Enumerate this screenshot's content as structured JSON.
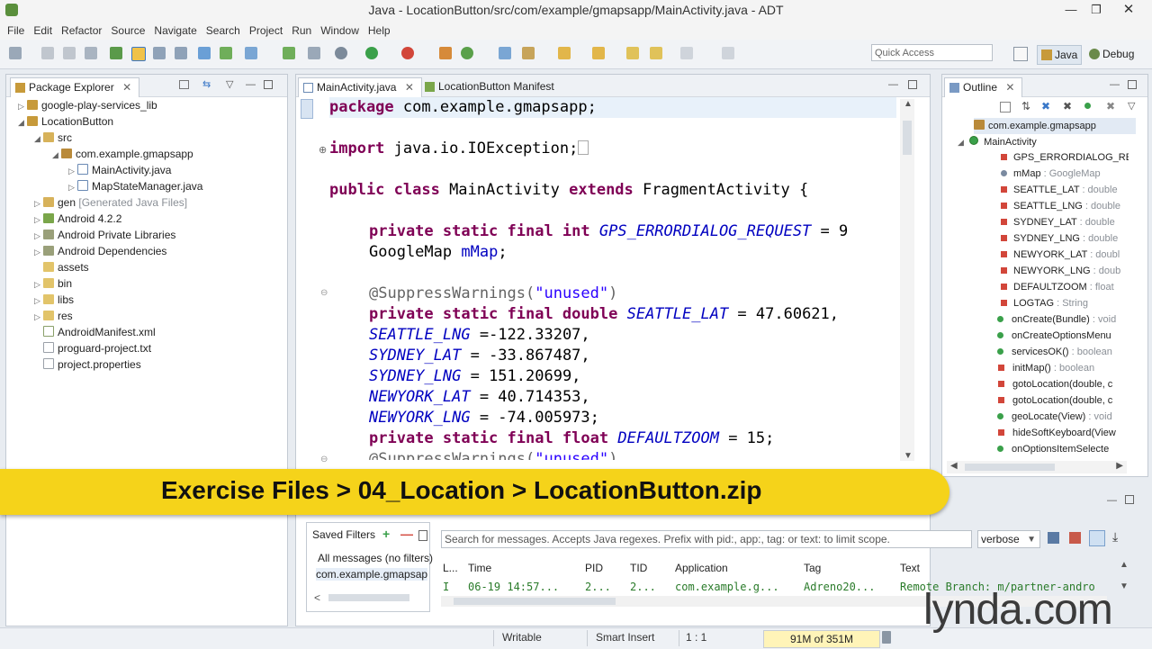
{
  "window": {
    "title": "Java - LocationButton/src/com/example/gmapsapp/MainActivity.java - ADT"
  },
  "menu": [
    "File",
    "Edit",
    "Refactor",
    "Source",
    "Navigate",
    "Search",
    "Project",
    "Run",
    "Window",
    "Help"
  ],
  "toolbar": {
    "quick_access_placeholder": "Quick Access",
    "java_label": "Java",
    "debug_label": "Debug"
  },
  "package_explorer": {
    "tab_label": "Package Explorer",
    "items": [
      {
        "label": "google-play-services_lib"
      },
      {
        "label": "LocationButton"
      },
      {
        "label": "src"
      },
      {
        "label": "com.example.gmapsapp"
      },
      {
        "label": "MainActivity.java"
      },
      {
        "label": "MapStateManager.java"
      },
      {
        "label": "gen",
        "suffix": "[Generated Java Files]"
      },
      {
        "label": "Android 4.2.2"
      },
      {
        "label": "Android Private Libraries"
      },
      {
        "label": "Android Dependencies"
      },
      {
        "label": "assets"
      },
      {
        "label": "bin"
      },
      {
        "label": "libs"
      },
      {
        "label": "res"
      },
      {
        "label": "AndroidManifest.xml"
      },
      {
        "label": "proguard-project.txt"
      },
      {
        "label": "project.properties"
      }
    ]
  },
  "editor": {
    "tabs": [
      "MainActivity.java",
      "LocationButton Manifest"
    ],
    "code": {
      "l1_kw": "package",
      "l1_rest": " com.example.gmapsapp;",
      "l2_kw": "import",
      "l2_rest": " java.io.IOException;",
      "l3_kw1": "public class",
      "l3_mid": " MainActivity ",
      "l3_kw2": "extends",
      "l3_rest": " FragmentActivity {",
      "l4_kw": "private static final int",
      "l4_field": "GPS_ERRORDIALOG_REQUEST",
      "l4_rest": " = 9",
      "l5_type": "GoogleMap ",
      "l5_field": "mMap",
      "l5_rest": ";",
      "l6_anno": "@SuppressWarnings(",
      "l6_str": "\"unused\"",
      "l6_end": ")",
      "l7_kw": "private static final double",
      "l7_field": "SEATTLE_LAT",
      "l7_rest": " = 47.60621,",
      "l8_field": "SEATTLE_LNG",
      "l8_rest": " =-122.33207,",
      "l9_field": "SYDNEY_LAT",
      "l9_rest": " = -33.867487,",
      "l10_field": "SYDNEY_LNG",
      "l10_rest": " = 151.20699,",
      "l11_field": "NEWYORK_LAT",
      "l11_rest": " = 40.714353,",
      "l12_field": "NEWYORK_LNG",
      "l12_rest": " = -74.005973;",
      "l13_kw": "private static final float",
      "l13_field": "DEFAULTZOOM",
      "l13_rest": " = 15;",
      "l14_anno": "@SuppressWarnings(",
      "l14_str": "\"unused\"",
      "l14_end": ")"
    }
  },
  "outline": {
    "tab_label": "Outline",
    "package": "com.example.gmapsapp",
    "class": "MainActivity",
    "members": [
      {
        "name": "GPS_ERRORDIALOG_RE",
        "type": ""
      },
      {
        "name": "mMap",
        "type": ": GoogleMap"
      },
      {
        "name": "SEATTLE_LAT",
        "type": ": double"
      },
      {
        "name": "SEATTLE_LNG",
        "type": ": double"
      },
      {
        "name": "SYDNEY_LAT",
        "type": ": double"
      },
      {
        "name": "SYDNEY_LNG",
        "type": ": double"
      },
      {
        "name": "NEWYORK_LAT",
        "type": ": doubl"
      },
      {
        "name": "NEWYORK_LNG",
        "type": ": doub"
      },
      {
        "name": "DEFAULTZOOM",
        "type": ": float"
      },
      {
        "name": "LOGTAG",
        "type": ": String"
      },
      {
        "name": "onCreate(Bundle)",
        "type": ": void"
      },
      {
        "name": "onCreateOptionsMenu",
        "type": ""
      },
      {
        "name": "servicesOK()",
        "type": ": boolean"
      },
      {
        "name": "initMap()",
        "type": ": boolean"
      },
      {
        "name": "gotoLocation(double, c",
        "type": ""
      },
      {
        "name": "gotoLocation(double, c",
        "type": ""
      },
      {
        "name": "geoLocate(View)",
        "type": ": void"
      },
      {
        "name": "hideSoftKeyboard(View",
        "type": ""
      },
      {
        "name": "onOptionsItemSelecte",
        "type": ""
      }
    ]
  },
  "banner": {
    "text": "Exercise Files > 04_Location > LocationButton.zip"
  },
  "logcat": {
    "saved_filters": "Saved Filters",
    "filters": [
      "All messages (no filters)",
      "com.example.gmapsapp"
    ],
    "search_placeholder": "Search for messages. Accepts Java regexes. Prefix with pid:, app:, tag: or text: to limit scope.",
    "level": "verbose",
    "columns": [
      "L...",
      "Time",
      "PID",
      "TID",
      "Application",
      "Tag",
      "Text"
    ],
    "row": [
      "I",
      "06-19 14:57...",
      "2...",
      "2...",
      "com.example.g...",
      "Adreno20...",
      "Remote Branch: m/partner-andro"
    ]
  },
  "status": {
    "writable": "Writable",
    "insert": "Smart Insert",
    "position": "1 : 1",
    "memory": "91M of 351M"
  },
  "watermark": "lynda.com",
  "colors": {
    "banner": "#f5d31a",
    "keyword": "#7f0055",
    "field": "#0000c0",
    "string": "#2a00ff"
  }
}
